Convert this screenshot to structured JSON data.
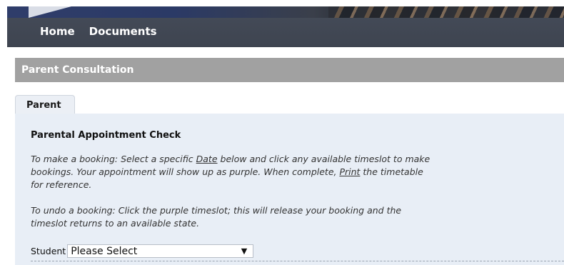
{
  "nav": {
    "items": [
      {
        "label": "Home"
      },
      {
        "label": "Documents"
      }
    ]
  },
  "section": {
    "title": "Parent Consultation"
  },
  "tabs": [
    {
      "label": "Parent",
      "active": true
    }
  ],
  "panel": {
    "title": "Parental Appointment Check",
    "instructions": {
      "p1_part1": "To make a booking: Select a specific ",
      "p1_link1": "Date",
      "p1_part2": " below and click any available timeslot to make bookings. Your appointment will show up as purple. When complete, ",
      "p1_link2": "Print",
      "p1_part3": " the timetable for reference.",
      "p2": "To undo a booking: Click the purple timeslot; this will release your booking and the timeslot returns to an available state."
    },
    "student": {
      "label": "Student",
      "selected": "Please Select"
    }
  },
  "colors": {
    "nav_bar": "#424956",
    "section_header": "#a1a1a1",
    "panel_bg": "#e8eef6"
  }
}
